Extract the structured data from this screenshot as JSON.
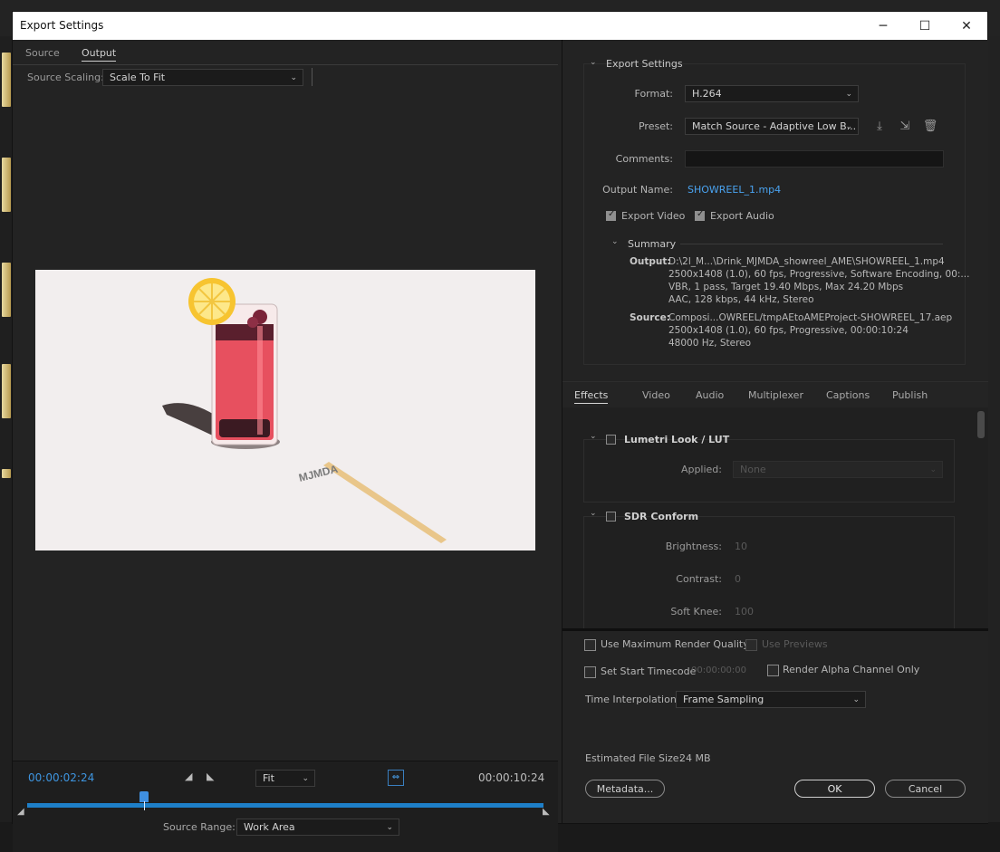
{
  "window": {
    "title": "Export Settings",
    "controls": {
      "minimize": "─",
      "maximize": "☐",
      "close": "✕"
    }
  },
  "left": {
    "tabs": [
      {
        "label": "Source"
      },
      {
        "label": "Output"
      }
    ],
    "source_scaling": {
      "label": "Source Scaling:",
      "value": "Scale To Fit"
    },
    "preview": {
      "sticker_text": "MJMDA"
    },
    "timeline": {
      "current_time": "00:00:02:24",
      "duration": "00:00:10:24",
      "zoom": "Fit",
      "playhead_fraction": 0.227,
      "source_range_label": "Source Range:",
      "source_range_value": "Work Area"
    }
  },
  "export_settings": {
    "header": "Export Settings",
    "format_label": "Format:",
    "format_value": "H.264",
    "preset_label": "Preset:",
    "preset_value": "Match Source - Adaptive Low B...",
    "comments_label": "Comments:",
    "comments_value": "",
    "output_name_label": "Output Name:",
    "output_name_value": "SHOWREEL_1.mp4",
    "export_video_label": "Export Video",
    "export_audio_label": "Export Audio",
    "summary": {
      "header": "Summary",
      "output_label": "Output:",
      "output_lines": [
        "D:\\2l_M...\\Drink_MJMDA_showreel_AME\\SHOWREEL_1.mp4",
        "2500x1408 (1.0), 60 fps, Progressive, Software Encoding, 00:...",
        "VBR, 1 pass, Target 19.40 Mbps, Max 24.20 Mbps",
        "AAC, 128 kbps, 44 kHz, Stereo"
      ],
      "source_label": "Source:",
      "source_lines": [
        "Composi...OWREEL/tmpAEtoAMEProject-SHOWREEL_17.aep",
        "2500x1408 (1.0), 60 fps, Progressive, 00:00:10:24",
        "48000 Hz, Stereo"
      ]
    }
  },
  "effects_tabs": [
    {
      "label": "Effects"
    },
    {
      "label": "Video"
    },
    {
      "label": "Audio"
    },
    {
      "label": "Multiplexer"
    },
    {
      "label": "Captions"
    },
    {
      "label": "Publish"
    }
  ],
  "effects": {
    "lumetri": {
      "title": "Lumetri Look / LUT",
      "applied_label": "Applied:",
      "applied_value": "None"
    },
    "sdr": {
      "title": "SDR Conform",
      "brightness_label": "Brightness:",
      "brightness_value": "10",
      "contrast_label": "Contrast:",
      "contrast_value": "0",
      "softknee_label": "Soft Knee:",
      "softknee_value": "100"
    }
  },
  "bottom": {
    "max_render_quality": "Use Maximum Render Quality",
    "use_previews": "Use Previews",
    "set_start_timecode": "Set Start Timecode",
    "start_timecode_value": "00:00:00:00",
    "render_alpha": "Render Alpha Channel Only",
    "time_interp_label": "Time Interpolation:",
    "time_interp_value": "Frame Sampling",
    "file_size_label": "Estimated File Size:",
    "file_size_value": "24 MB",
    "metadata_button": "Metadata...",
    "ok_button": "OK",
    "cancel_button": "Cancel"
  },
  "colors": {
    "accent": "#4aa3f0",
    "timeline_bar": "#1e7fc8"
  }
}
